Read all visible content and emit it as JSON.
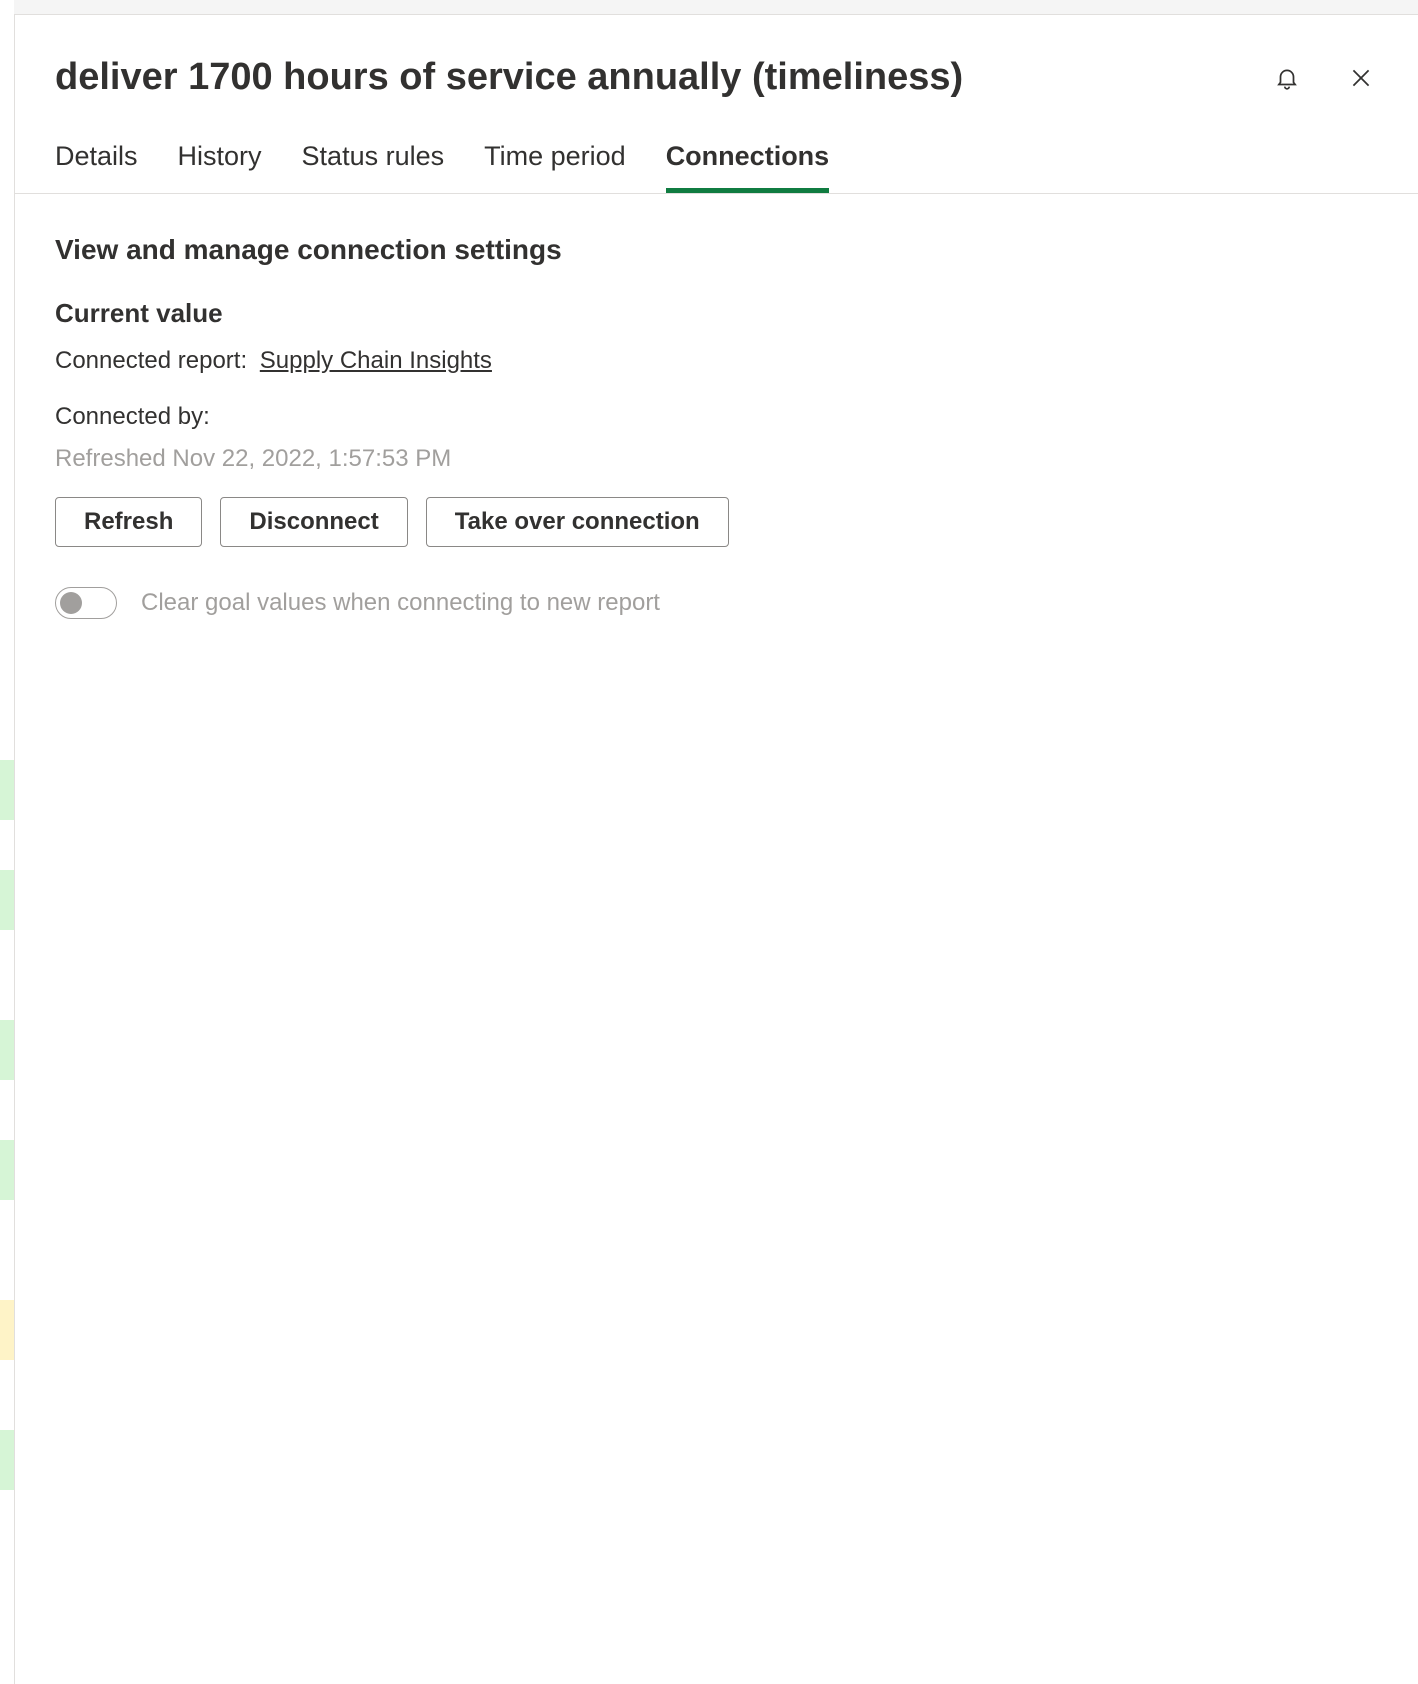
{
  "header": {
    "title": "deliver 1700 hours of service annually (timeliness)"
  },
  "tabs": [
    {
      "label": "Details",
      "active": false
    },
    {
      "label": "History",
      "active": false
    },
    {
      "label": "Status rules",
      "active": false
    },
    {
      "label": "Time period",
      "active": false
    },
    {
      "label": "Connections",
      "active": true
    }
  ],
  "content": {
    "section_title": "View and manage connection settings",
    "current_value": {
      "heading": "Current value",
      "connected_report_label": "Connected report:",
      "connected_report_name": "Supply Chain Insights",
      "connected_by_label": "Connected by:",
      "connected_by_value": "",
      "refreshed_label": "Refreshed Nov 22, 2022, 1:57:53 PM"
    },
    "buttons": {
      "refresh": "Refresh",
      "disconnect": "Disconnect",
      "take_over": "Take over connection"
    },
    "toggle": {
      "state": "off",
      "label": "Clear goal values when connecting to new report"
    }
  },
  "colors": {
    "accent": "#107c41",
    "text": "#323130",
    "muted": "#a19f9d",
    "border": "#e1dfdd",
    "strip_green": "#d6f5d6",
    "strip_yellow": "#fef3c7"
  }
}
